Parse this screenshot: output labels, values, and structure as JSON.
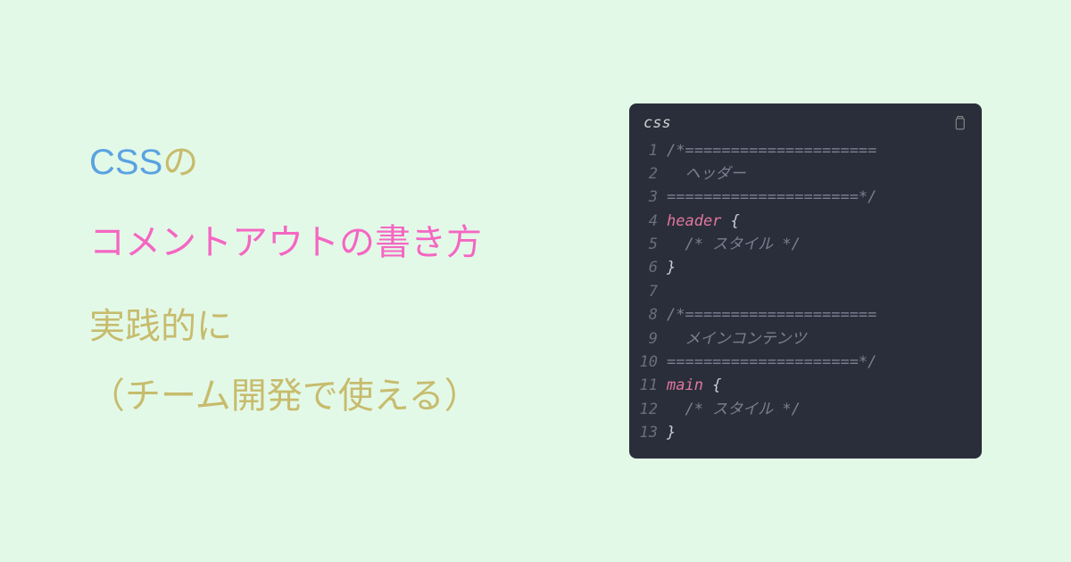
{
  "heading": {
    "line1_css": "CSS",
    "line1_no": "の",
    "line2": "コメントアウトの書き方",
    "line3": "実践的に",
    "line4": "（チーム開発で使える）"
  },
  "code": {
    "language": "css",
    "clipboard_label": "copy",
    "lines": [
      {
        "num": "1",
        "tokens": [
          {
            "cls": "tok-comment",
            "text": "/*====================="
          }
        ]
      },
      {
        "num": "2",
        "tokens": [
          {
            "cls": "tok-comment",
            "text": "  ヘッダー"
          }
        ]
      },
      {
        "num": "3",
        "tokens": [
          {
            "cls": "tok-comment",
            "text": "=====================*/"
          }
        ]
      },
      {
        "num": "4",
        "tokens": [
          {
            "cls": "tok-selector",
            "text": "header"
          },
          {
            "cls": "tok-brace",
            "text": " {"
          }
        ]
      },
      {
        "num": "5",
        "tokens": [
          {
            "cls": "tok-comment",
            "text": "  /* スタイル */"
          }
        ]
      },
      {
        "num": "6",
        "tokens": [
          {
            "cls": "tok-brace",
            "text": "}"
          }
        ]
      },
      {
        "num": "7",
        "tokens": [
          {
            "cls": "tok-brace",
            "text": ""
          }
        ]
      },
      {
        "num": "8",
        "tokens": [
          {
            "cls": "tok-comment",
            "text": "/*====================="
          }
        ]
      },
      {
        "num": "9",
        "tokens": [
          {
            "cls": "tok-comment",
            "text": "  メインコンテンツ"
          }
        ]
      },
      {
        "num": "10",
        "tokens": [
          {
            "cls": "tok-comment",
            "text": "=====================*/"
          }
        ]
      },
      {
        "num": "11",
        "tokens": [
          {
            "cls": "tok-selector",
            "text": "main"
          },
          {
            "cls": "tok-brace",
            "text": " {"
          }
        ]
      },
      {
        "num": "12",
        "tokens": [
          {
            "cls": "tok-comment",
            "text": "  /* スタイル */"
          }
        ]
      },
      {
        "num": "13",
        "tokens": [
          {
            "cls": "tok-brace",
            "text": "}"
          }
        ]
      }
    ]
  }
}
